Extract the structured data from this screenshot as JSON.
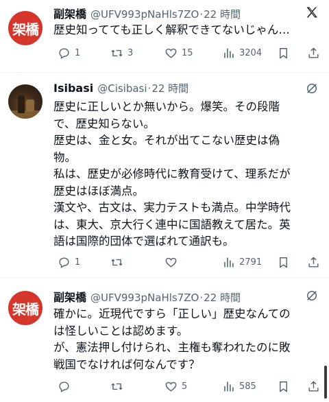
{
  "tweets": [
    {
      "avatar_text": "架橋",
      "name": "副架橋",
      "handle": "@UFV993pNaHls7ZO",
      "dot": "·",
      "time": "22 時間",
      "lines": [
        "歴史知ってても正しく解釈できてないじゃん…"
      ],
      "replies": "1",
      "retweets": "3",
      "likes": "15",
      "views": "3204"
    },
    {
      "name": "Isibasi",
      "handle": "@Cisibasi",
      "dot": "·",
      "time": "22 時間",
      "lines": [
        "歴史に正しいとか無いから。爆笑。その段階",
        "で、歴史知らない。",
        "歴史は、金と女。それが出てこない歴史は偽",
        "物。",
        "私は、歴史が必修時代に教育受けて、理系だが",
        "歴史はほぼ満点。",
        "漢文や、古文は、実力テストも満点。中学時代",
        "は、東大、京大行く連中に国語教えて居た。英",
        "語は国際的団体で選ばれて通訳も。"
      ],
      "replies": "1",
      "retweets": "",
      "likes": "",
      "views": "2791"
    },
    {
      "avatar_text": "架橋",
      "name": "副架橋",
      "handle": "@UFV993pNaHls7ZO",
      "dot": "·",
      "time": "22 時間",
      "lines": [
        "確かに。近現代ですら「正しい」歴史なんての",
        "は怪しいことは認めます。",
        "が、憲法押し付けられ、主権も奪われたのに敗",
        "戦国でなければ何なんです？"
      ],
      "replies": "",
      "retweets": "",
      "likes": "5",
      "views": "585"
    }
  ],
  "icons": {
    "platform": "x-logo-icon",
    "grok": "grok-icon",
    "reply": "reply-icon",
    "retweet": "retweet-icon",
    "like": "heart-icon",
    "views": "views-icon",
    "bookmark": "bookmark-icon",
    "share": "share-icon"
  },
  "colors": {
    "avatar_red": "#d5362c",
    "text": "#0f1419",
    "muted": "#536471"
  }
}
